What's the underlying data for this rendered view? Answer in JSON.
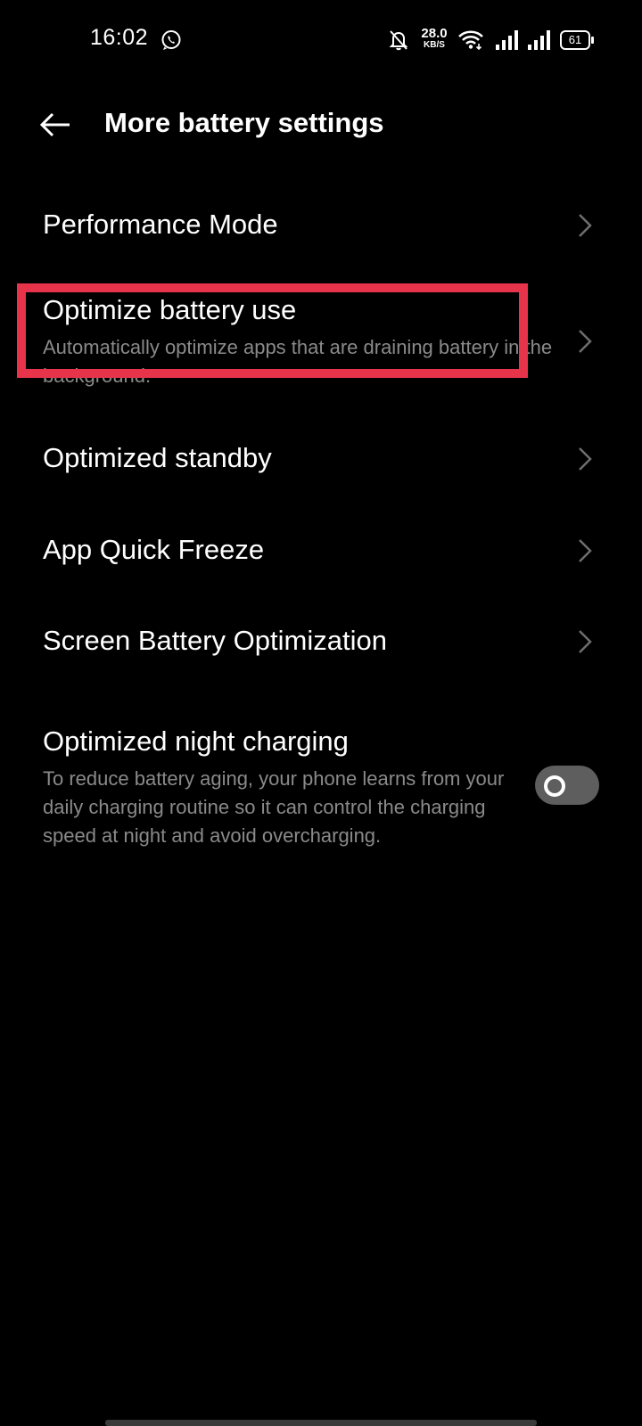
{
  "status_bar": {
    "time": "16:02",
    "net_speed_value": "28.0",
    "net_speed_unit": "KB/S",
    "battery_level": "61",
    "icons": [
      "whatsapp-icon",
      "mute-icon",
      "wifi-icon",
      "signal-icon",
      "signal-icon",
      "battery-icon"
    ]
  },
  "header": {
    "title": "More battery settings",
    "back_icon": "arrow-left-icon"
  },
  "items": [
    {
      "title": "Performance Mode"
    },
    {
      "title": "Optimize battery use",
      "subtitle": "Automatically optimize apps that are draining battery in the background."
    },
    {
      "title": "Optimized standby"
    },
    {
      "title": "App Quick Freeze"
    },
    {
      "title": "Screen Battery Optimization"
    },
    {
      "title": "Optimized night charging",
      "subtitle": "To reduce battery aging, your phone learns from your daily charging routine so it can control the charging speed at night and avoid overcharging.",
      "toggle_on": false
    }
  ],
  "colors": {
    "background": "#000000",
    "text_primary": "#ffffff",
    "text_secondary": "#8a8a8a",
    "highlight": "#e8344a",
    "toggle_off": "#5e5e5e"
  }
}
